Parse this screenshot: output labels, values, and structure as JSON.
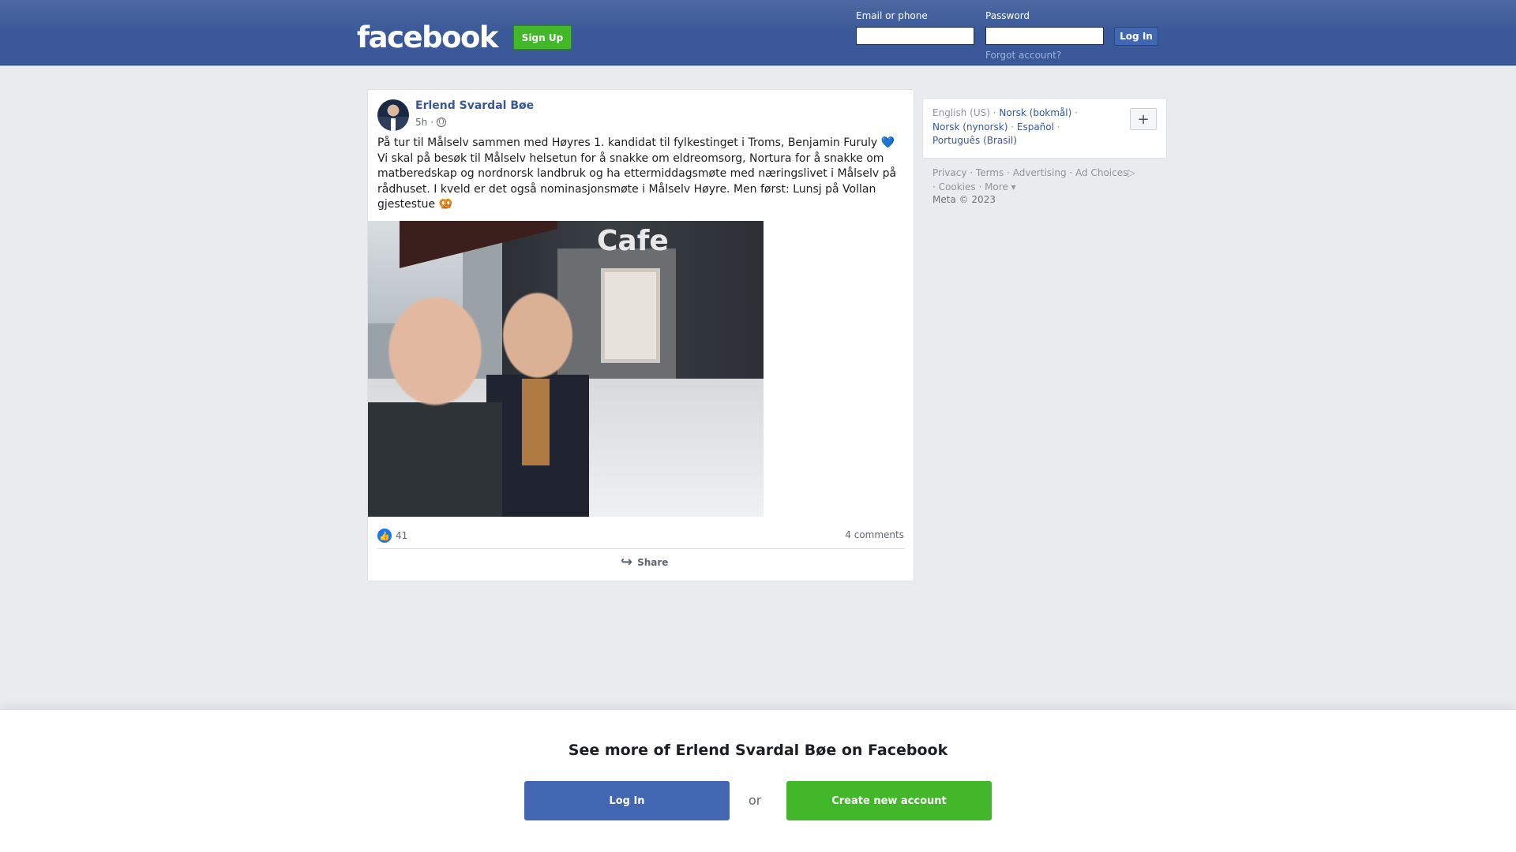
{
  "header": {
    "logo": "facebook",
    "signup_label": "Sign Up",
    "email_label": "Email or phone",
    "password_label": "Password",
    "login_label": "Log In",
    "forgot_label": "Forgot account?"
  },
  "post": {
    "author": "Erlend Svardal Bøe",
    "time": "5h",
    "separator": "·",
    "text_line1": "På tur til Målselv sammen med Høyres 1. kandidat til fylkestinget i Troms, Benjamin Furuly",
    "text_heart": "💙",
    "text_rest": "Vi skal på besøk til Målselv helsetun for å snakke om eldreomsorg, Nortura for å snakke om matberedskap og nordnorsk landbruk og ha ettermiddagsmøte med næringslivet i Målselv på rådhuset. I kveld er det også nominasjonsmøte i Målselv Høyre. Men først: Lunsj på Vollan gjestestue",
    "text_emoji": "🥨",
    "photo_sign": "Cafe",
    "like_count": "41",
    "comments": "4 comments",
    "share_label": "Share"
  },
  "sidebar": {
    "languages": [
      {
        "label": "English (US)"
      },
      {
        "label": "Norsk (bokmål)"
      },
      {
        "label": "Norsk (nynorsk)"
      },
      {
        "label": "Español"
      },
      {
        "label": "Português (Brasil)"
      }
    ],
    "plus_label": "+",
    "footer_links": [
      "Privacy",
      "Terms",
      "Advertising",
      "Ad Choices",
      "Cookies",
      "More"
    ],
    "copyright": "Meta © 2023"
  },
  "banner": {
    "title": "See more of Erlend Svardal Bøe on Facebook",
    "login_label": "Log In",
    "or_label": "or",
    "create_label": "Create new account"
  },
  "colors": {
    "brand_blue": "#3b5998",
    "green": "#42b72a",
    "link": "#385898"
  }
}
